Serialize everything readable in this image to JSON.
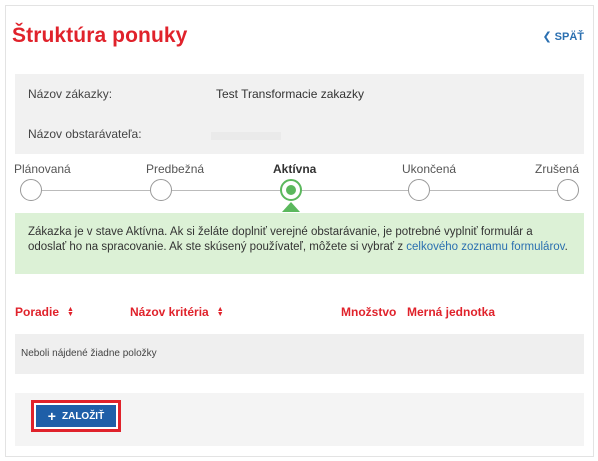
{
  "header": {
    "title": "Štruktúra ponuky",
    "back_label": "SPÄŤ"
  },
  "info": {
    "rows": [
      {
        "label": "Názov zákazky:",
        "value": "Test Transformacie zakazky"
      },
      {
        "label": "Názov obstarávateľa:",
        "value": ""
      }
    ]
  },
  "steps": [
    {
      "label": "Plánovaná",
      "active": false
    },
    {
      "label": "Predbežná",
      "active": false
    },
    {
      "label": "Aktívna",
      "active": true
    },
    {
      "label": "Ukončená",
      "active": false
    },
    {
      "label": "Zrušená",
      "active": false
    }
  ],
  "alert": {
    "text": "Zákazka je v stave Aktívna. Ak si želáte doplniť verejné obstarávanie, je potrebné vyplniť formulár a odoslať ho na spracovanie. Ak ste skúsený používateľ, môžete si vybrať z ",
    "link": "celkového zoznamu formulárov",
    "end": "."
  },
  "table": {
    "columns": [
      "Poradie",
      "Názov kritéria",
      "Množstvo",
      "Merná jednotka"
    ],
    "empty_text": "Neboli nájdené žiadne položky"
  },
  "actions": {
    "create_label": "ZALOŽIŤ"
  },
  "colors": {
    "accent_red": "#e0222b",
    "link_blue": "#2a6fb0",
    "button_blue": "#1f5fa8",
    "success_green": "#5bb85d",
    "alert_bg": "#dcf1d6"
  }
}
